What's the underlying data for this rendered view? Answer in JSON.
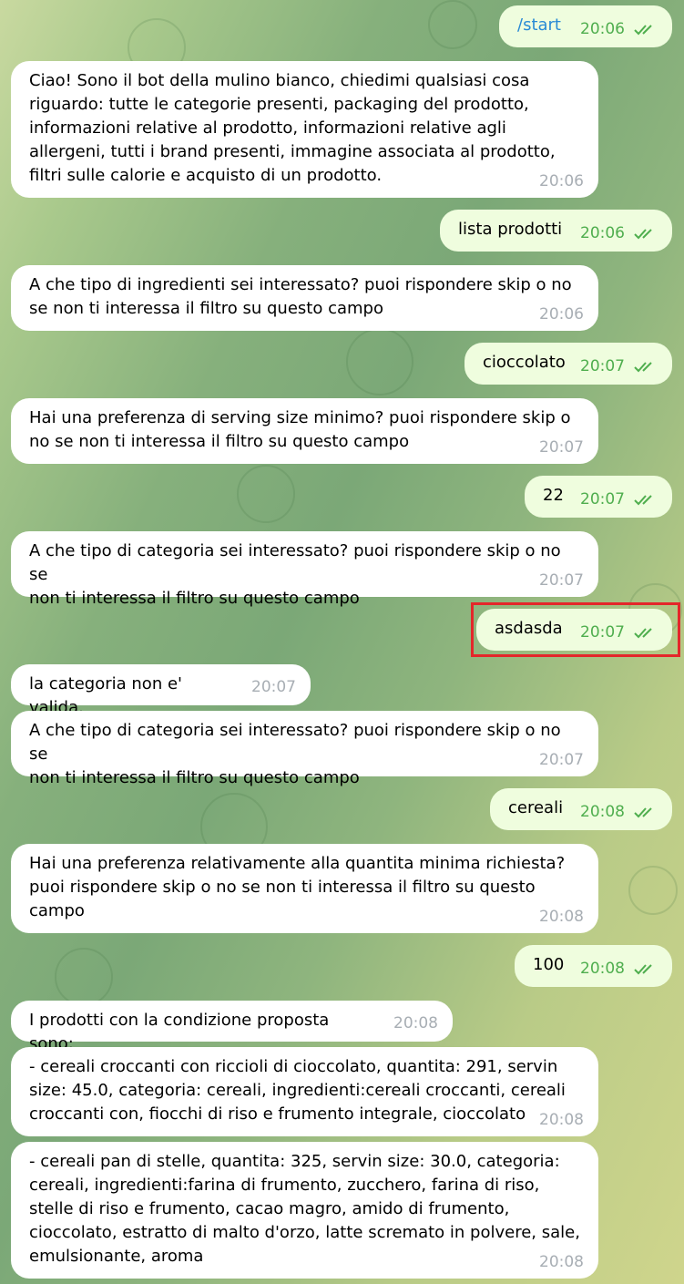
{
  "messages": [
    {
      "dir": "out",
      "text": "/start",
      "time": "20:06"
    },
    {
      "dir": "in",
      "text": "Ciao! Sono il bot della mulino bianco, chiedimi qualsiasi cosa\nriguardo: tutte le categorie presenti, packaging del prodotto,\ninformazioni relative al prodotto, informazioni relative agli\nallergeni, tutti i brand presenti, immagine associata al prodotto,\nfiltri sulle calorie e acquisto di un prodotto.",
      "time": "20:06"
    },
    {
      "dir": "out",
      "text": "lista prodotti",
      "time": "20:06"
    },
    {
      "dir": "in",
      "text": "A che tipo di ingredienti sei interessato? puoi rispondere skip o no\nse non ti interessa il filtro su questo campo",
      "time": "20:06"
    },
    {
      "dir": "out",
      "text": "cioccolato",
      "time": "20:07"
    },
    {
      "dir": "in",
      "text": "Hai una preferenza di serving size minimo? puoi rispondere skip o\nno se non ti interessa il filtro su questo campo",
      "time": "20:07"
    },
    {
      "dir": "out",
      "text": "22",
      "time": "20:07"
    },
    {
      "dir": "in",
      "text": "A che tipo di categoria sei interessato? puoi rispondere skip o no se\nnon ti interessa il filtro su questo campo",
      "time": "20:07"
    },
    {
      "dir": "out",
      "text": "asdasda",
      "time": "20:07"
    },
    {
      "dir": "in",
      "text": "la categoria non e' valida.",
      "time": "20:07"
    },
    {
      "dir": "in",
      "text": "A che tipo di categoria sei interessato? puoi rispondere skip o no se\nnon ti interessa il filtro su questo campo",
      "time": "20:07"
    },
    {
      "dir": "out",
      "text": "cereali",
      "time": "20:08"
    },
    {
      "dir": "in",
      "text": "Hai una preferenza relativamente alla quantita minima richiesta?\npuoi rispondere skip o no se non ti interessa il filtro su questo\ncampo",
      "time": "20:08"
    },
    {
      "dir": "out",
      "text": "100",
      "time": "20:08"
    },
    {
      "dir": "in",
      "text": "I prodotti con la condizione proposta sono:",
      "time": "20:08"
    },
    {
      "dir": "in",
      "text": "- cereali croccanti con riccioli di cioccolato, quantita: 291, servin\nsize: 45.0, categoria: cereali, ingredienti:cereali croccanti, cereali\ncroccanti con, fiocchi di riso e frumento integrale, cioccolato",
      "time": "20:08"
    },
    {
      "dir": "in",
      "text": "- cereali pan di stelle, quantita: 325, servin size: 30.0, categoria:\ncereali, ingredienti:farina di frumento, zucchero, farina di riso,\nstelle di riso e frumento, cacao magro, amido di frumento,\ncioccolato, estratto di malto d'orzo, latte scremato in polvere, sale,\nemulsionante, aroma",
      "time": "20:08"
    }
  ],
  "colors": {
    "incoming_bubble": "#ffffff",
    "outgoing_bubble": "#effdde",
    "outgoing_time": "#4fae4e",
    "incoming_time": "#a8aeb4",
    "highlight_border": "#e4262a",
    "command_link": "#2a8bd5"
  },
  "icons": {
    "read_receipt": "double-check-icon"
  },
  "highlighted_message_index": 8
}
